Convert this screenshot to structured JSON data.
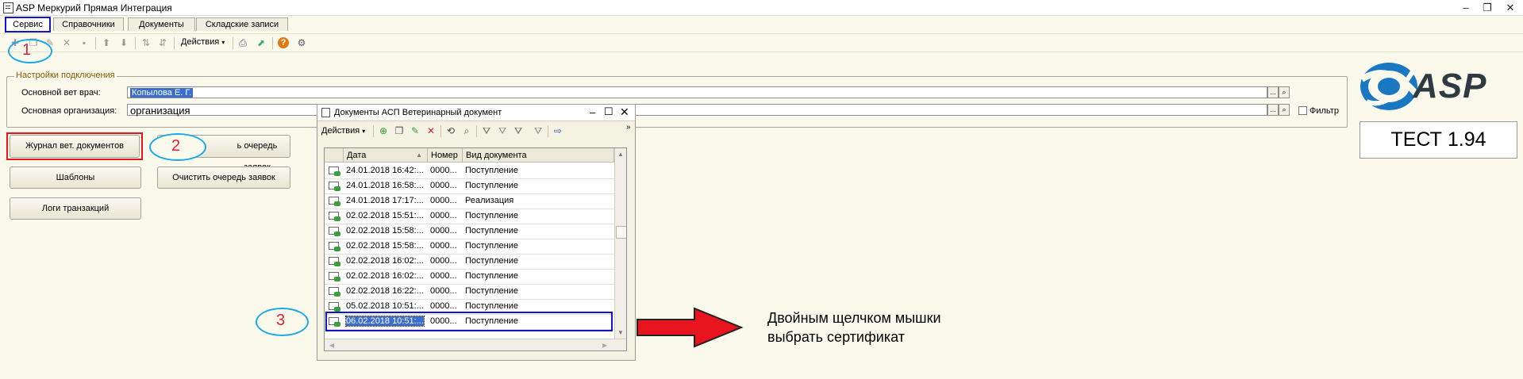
{
  "window": {
    "title": "ASP Меркурий Прямая Интеграция",
    "controls": {
      "minimize": "–",
      "restore": "❐",
      "close": "✕"
    }
  },
  "tabs": [
    {
      "label": "Сервис",
      "active": true
    },
    {
      "label": "Справочники",
      "active": false
    },
    {
      "label": "Документы",
      "active": false
    },
    {
      "label": "Складские записи",
      "active": false
    }
  ],
  "toolbar": {
    "actions_label": "Действия",
    "icons": [
      "add-icon",
      "copy-icon",
      "delete-icon",
      "save-icon",
      "up-arrow-icon",
      "down-arrow-icon",
      "sort-asc-icon",
      "sort-desc-icon",
      "print-icon",
      "export-icon",
      "help-icon",
      "settings-icon"
    ]
  },
  "settings": {
    "legend": "Настройки подключения",
    "vet_doctor_label": "Основной вет врач:",
    "vet_doctor_value": "Копылова Е. Г.",
    "org_label": "Основная организация:",
    "org_value": "организация",
    "filter_label": "Фильтр",
    "select_button": "...",
    "open_button": "🔍"
  },
  "buttons": {
    "journal": "Журнал вет. документов",
    "queue": "ь очередь заявок",
    "templates": "Шаблоны",
    "clear_queue": "Очистить очередь заявок",
    "logs": "Логи транзакций"
  },
  "brand": {
    "logo_text": "ASP",
    "version": "ТЕСТ 1.94",
    "colors": {
      "logo_blue": "#1a78c2",
      "logo_gray": "#2f3a42"
    }
  },
  "doc_window": {
    "title": "Документы АСП Ветеринарный документ",
    "actions_label": "Действия",
    "columns": [
      "Дата",
      "Номер",
      "Вид документа"
    ],
    "rows": [
      {
        "date": "24.01.2018 16:42:...",
        "number": "0000...",
        "type": "Поступление"
      },
      {
        "date": "24.01.2018 16:58:...",
        "number": "0000...",
        "type": "Поступление"
      },
      {
        "date": "24.01.2018 17:17:...",
        "number": "0000...",
        "type": "Реализация"
      },
      {
        "date": "02.02.2018 15:51:...",
        "number": "0000...",
        "type": "Поступление"
      },
      {
        "date": "02.02.2018 15:58:...",
        "number": "0000...",
        "type": "Поступление"
      },
      {
        "date": "02.02.2018 15:58:...",
        "number": "0000...",
        "type": "Поступление"
      },
      {
        "date": "02.02.2018 16:02:...",
        "number": "0000...",
        "type": "Поступление"
      },
      {
        "date": "02.02.2018 16:02:...",
        "number": "0000...",
        "type": "Поступление"
      },
      {
        "date": "02.02.2018 16:22:...",
        "number": "0000...",
        "type": "Поступление"
      },
      {
        "date": "05.02.2018 10:51:...",
        "number": "0000...",
        "type": "Поступление"
      },
      {
        "date": "06.02.2018 10:51:...",
        "number": "0000...",
        "type": "Поступление",
        "selected": true
      }
    ]
  },
  "annotations": {
    "step1": "1",
    "step2": "2",
    "step3": "3",
    "note": "Двойным щелчком мышки выбрать сертификат",
    "colors": {
      "ellipse": "#1aa8e8",
      "number": "#e0203a",
      "highlight_red": "#e8141e",
      "highlight_blue": "#1015c8",
      "arrow": "#e8141e"
    }
  }
}
